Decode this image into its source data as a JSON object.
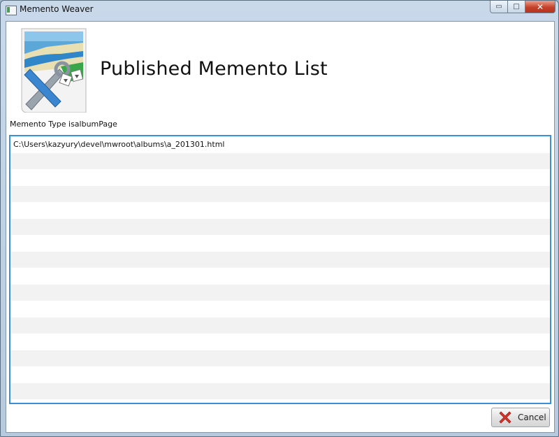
{
  "window": {
    "title": "Memento Weaver",
    "caption_buttons": {
      "minimize_glyph": "▭",
      "maximize_glyph": "□",
      "close_glyph": "✕"
    }
  },
  "header": {
    "icon": "memento-weaver-logo-icon",
    "title": "Published Memento List"
  },
  "memento_type_label": "Memento Type isalbumPage",
  "list": {
    "rows": [
      "C:\\Users\\kazyury\\devel\\mwroot\\albums\\a_201301.html",
      "",
      "",
      "",
      "",
      "",
      "",
      "",
      "",
      "",
      "",
      "",
      "",
      "",
      "",
      ""
    ]
  },
  "footer": {
    "cancel_label": "Cancel",
    "cancel_icon": "red-x-icon"
  },
  "colors": {
    "list_border": "#3c8fd6",
    "alt_row": "#f2f2f2",
    "close_button": "#c4422b"
  }
}
